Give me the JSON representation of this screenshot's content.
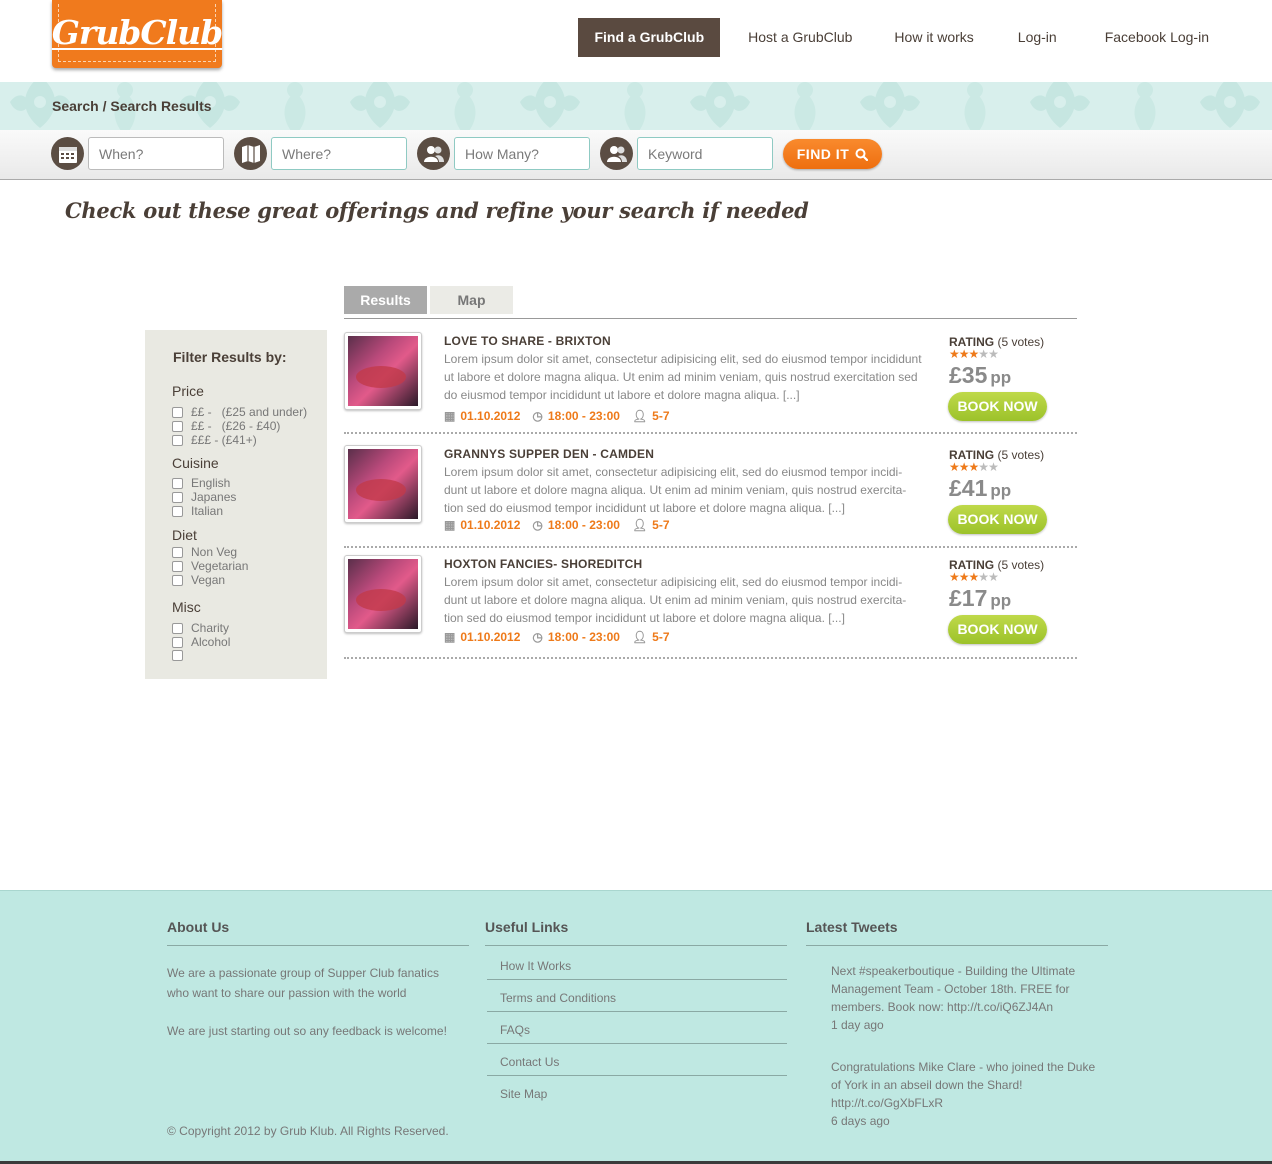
{
  "brand": {
    "logo": "GrubClub",
    "accent": "#f07a1d",
    "dark": "#5a4a40",
    "green": "#a8cc33"
  },
  "nav": {
    "items": [
      {
        "label": "Find a GrubClub"
      },
      {
        "label": "Host a GrubClub"
      },
      {
        "label": "How it works"
      },
      {
        "label": "Log-in"
      },
      {
        "label": "Facebook Log-in"
      }
    ]
  },
  "breadcrumb": "Search / Search Results",
  "search": {
    "when_placeholder": "When?",
    "where_placeholder": "Where?",
    "howmany_placeholder": "How Many?",
    "keyword_placeholder": "Keyword",
    "button_label": "FIND IT",
    "icons": [
      "calendar-icon",
      "map-icon",
      "people-icon",
      "people-icon",
      "search-icon"
    ]
  },
  "headline": "Check out these great offerings and refine your search if needed",
  "tabs": [
    {
      "label": "Results"
    },
    {
      "label": "Map"
    }
  ],
  "filter": {
    "title": "Filter Results by:",
    "groups": [
      {
        "title": "Price",
        "options": [
          "££ -   (£25 and under)",
          "££ -   (£26 - £40)",
          "£££ - (£41+)"
        ]
      },
      {
        "title": "Cuisine",
        "options": [
          "English",
          "Japanes",
          "Italian"
        ]
      },
      {
        "title": "Diet",
        "options": [
          "Non Veg",
          "Vegetarian",
          "Vegan"
        ]
      },
      {
        "title": "Misc",
        "options": [
          "Charity",
          "Alcohol",
          ""
        ]
      }
    ]
  },
  "results": [
    {
      "title": "LOVE TO SHARE - BRIXTON",
      "desc": "Lorem ipsum dolor sit amet, consectetur adipisicing elit, sed do eiusmod tempor incididunt ut labore et dolore magna aliqua. Ut enim ad minim veniam, quis nostrud exercitation  sed do eiusmod tempor incididunt ut labore et dolore magna aliqua. [...]",
      "date": "01.10.2012",
      "time": "18:00 - 23:00",
      "guests": "5-7",
      "rating_label": "RATING",
      "votes": "(5 votes)",
      "stars": 3,
      "stars_max": 5,
      "price": "£35",
      "pp": "pp",
      "book": "BOOK NOW"
    },
    {
      "title": "GRANNYS SUPPER DEN - CAMDEN",
      "desc": "Lorem ipsum dolor sit amet, consectetur adipisicing elit, sed do eiusmod tempor incidi- dunt ut labore et dolore magna aliqua. Ut enim ad minim veniam, quis nostrud exercita- tion  sed do eiusmod tempor incididunt ut labore et dolore magna aliqua. [...]",
      "date": "01.10.2012",
      "time": "18:00 - 23:00",
      "guests": "5-7",
      "rating_label": "RATING",
      "votes": "(5 votes)",
      "stars": 3,
      "stars_max": 5,
      "price": "£41",
      "pp": "pp",
      "book": "BOOK NOW"
    },
    {
      "title": "HOXTON FANCIES- SHOREDITCH",
      "desc": "Lorem ipsum dolor sit amet, consectetur adipisicing elit, sed do eiusmod tempor incidi- dunt ut labore et dolore magna aliqua. Ut enim ad minim veniam, quis nostrud exercita- tion  sed do eiusmod tempor incididunt ut labore et dolore magna aliqua. [...]",
      "date": "01.10.2012",
      "time": "18:00 - 23:00",
      "guests": "5-7",
      "rating_label": "RATING",
      "votes": "(5 votes)",
      "stars": 3,
      "stars_max": 5,
      "price": "£17",
      "pp": "pp",
      "book": "BOOK NOW"
    }
  ],
  "footer": {
    "about": {
      "title": "About Us",
      "p1": "We are a passionate group of Supper Club fanatics who want to share our passion with the world",
      "p2": "We are just starting out so any feedback is welcome!"
    },
    "links": {
      "title": "Useful Links",
      "items": [
        "How It Works",
        "Terms and Conditions",
        "FAQs",
        "Contact Us",
        "Site Map"
      ]
    },
    "tweets": {
      "title": "Latest Tweets",
      "items": [
        {
          "text": "Next #speakerboutique - Building the Ultimate Management Team - October 18th. FREE for members. Book now: http://t.co/iQ6ZJ4An",
          "ago": "1 day ago"
        },
        {
          "text": "Congratulations Mike Clare - who joined the Duke of York in an abseil down the Shard! http://t.co/GgXbFLxR",
          "ago": "6 days ago"
        }
      ]
    },
    "copyright": "© Copyright 2012 by Grub Klub. All Rights Reserved."
  }
}
